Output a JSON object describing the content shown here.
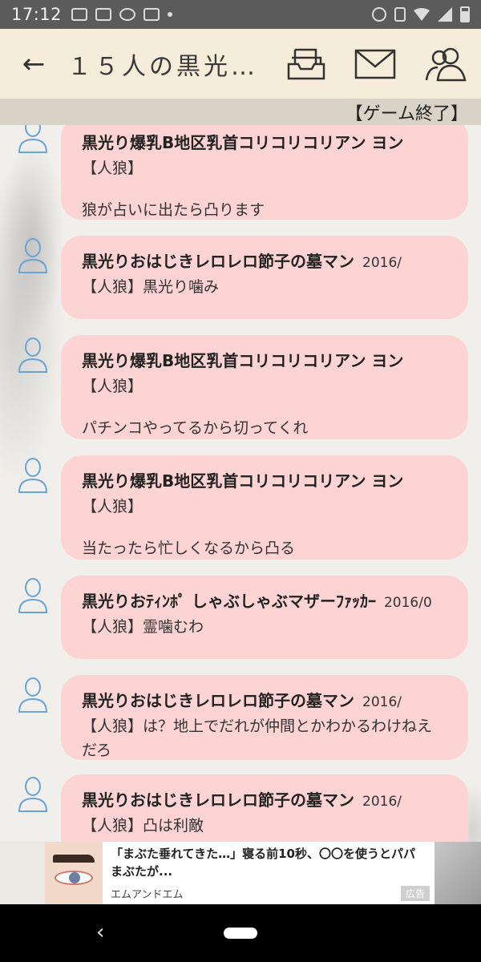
{
  "status_bar": {
    "time": "17:12"
  },
  "app_bar": {
    "title": "１５人の黒光…",
    "back_icon": "←"
  },
  "subbar": {
    "status": "【ゲーム終了】"
  },
  "messages": [
    {
      "name": "黒光り爆乳B地区乳首コリコリコリアン ヨン",
      "date": "",
      "role": "【人狼】",
      "text": "狼が占いに出たら凸ります",
      "inline": false
    },
    {
      "name": "黒光りおはじきレロレロ節子の墓マン",
      "date": "2016/",
      "role": "【人狼】",
      "text": "黒光り噛み",
      "inline": true
    },
    {
      "name": "黒光り爆乳B地区乳首コリコリコリアン ヨン",
      "date": "",
      "role": "【人狼】",
      "text": "パチンコやってるから切ってくれ",
      "inline": false
    },
    {
      "name": "黒光り爆乳B地区乳首コリコリコリアン ヨン",
      "date": "",
      "role": "【人狼】",
      "text": "当たったら忙しくなるから凸る",
      "inline": false
    },
    {
      "name": "黒光りおﾃｨﾝﾎﾟ しゃぶしゃぶマザーﾌｧｯｶｰ",
      "date": "2016/0",
      "role": "【人狼】",
      "text": "霊噛むわ",
      "inline": true
    },
    {
      "name": "黒光りおはじきレロレロ節子の墓マン",
      "date": "2016/",
      "role": "【人狼】",
      "text": "は？地上でだれが仲間とかわかるわけねえだろ",
      "inline": true
    },
    {
      "name": "黒光りおはじきレロレロ節子の墓マン",
      "date": "2016/",
      "role": "【人狼】",
      "text": "凸は利敵",
      "inline": true
    }
  ],
  "ad": {
    "headline": "「まぶた垂れてきた…」寝る前10秒、〇〇を使うとパパまぶたが...",
    "brand": "エムアンドエム",
    "badge": "広告"
  },
  "nav": {
    "back_icon": "‹"
  }
}
